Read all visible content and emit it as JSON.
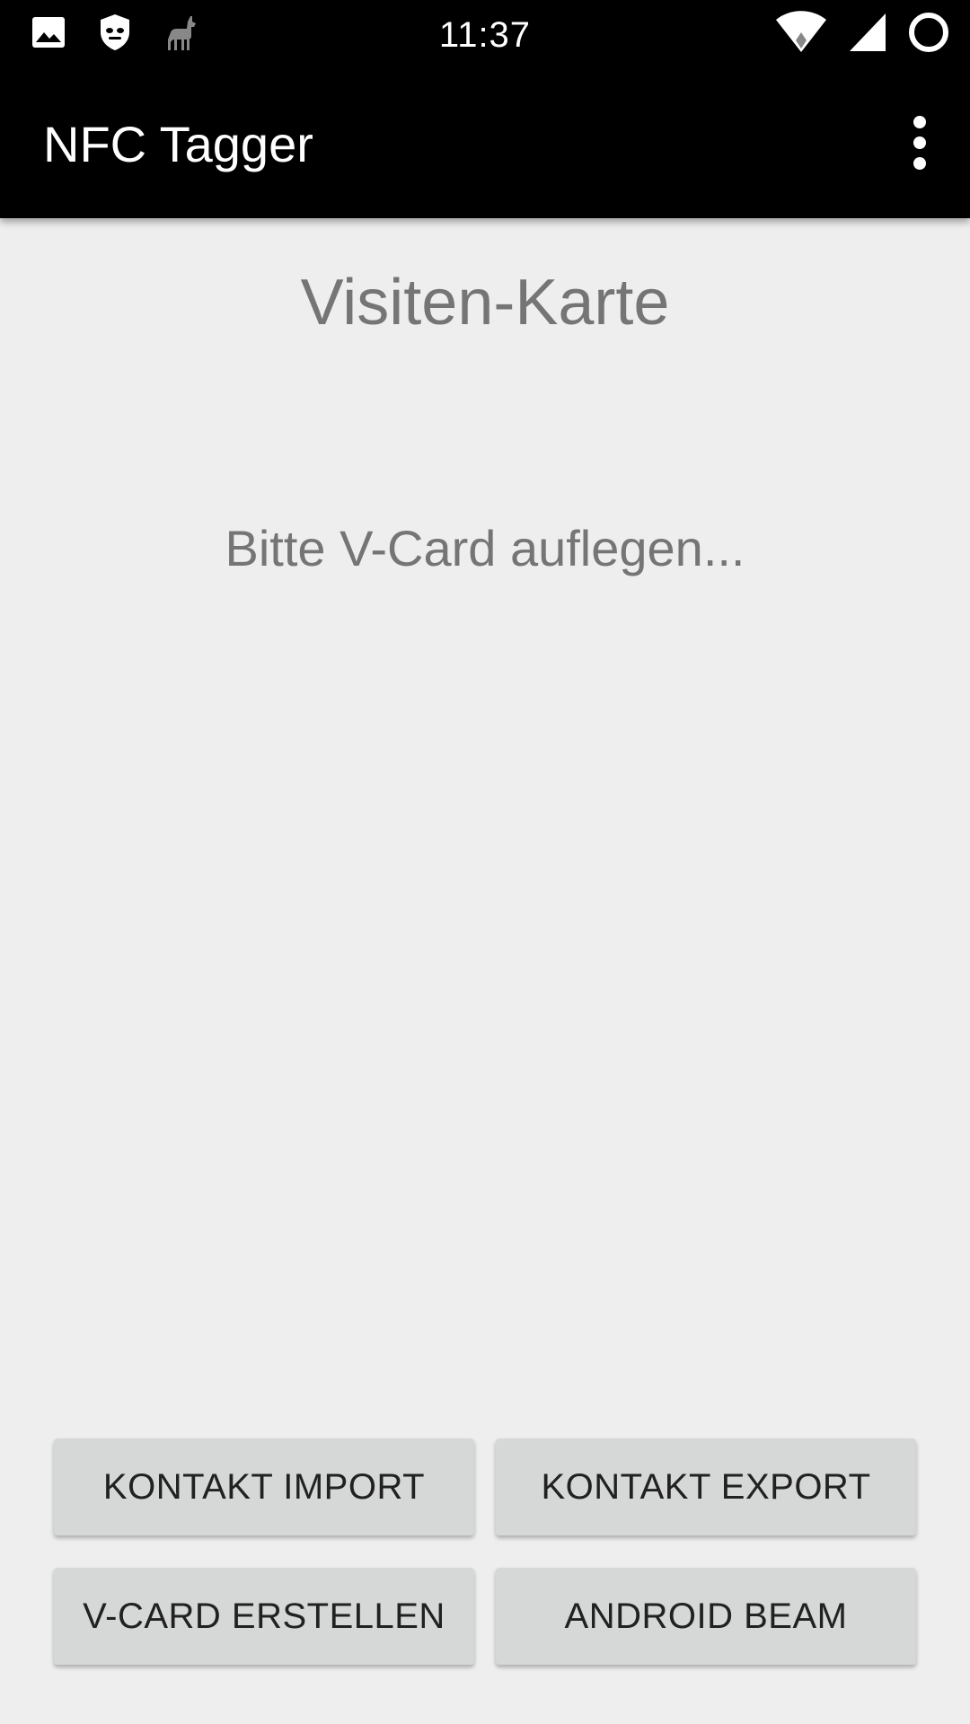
{
  "status_bar": {
    "time": "11:37",
    "left_icons": [
      "image-icon",
      "cyanogen-icon",
      "llama-icon"
    ],
    "right_icons": [
      "wifi-icon",
      "cell-signal-icon",
      "battery-ring-icon"
    ]
  },
  "app_bar": {
    "title": "NFC Tagger",
    "overflow_icon": "more-vert-icon"
  },
  "main": {
    "title": "Visiten-Karte",
    "prompt": "Bitte V-Card auflegen..."
  },
  "buttons": {
    "contact_import": "KONTAKT IMPORT",
    "contact_export": "KONTAKT EXPORT",
    "vcard_create": "V-CARD ERSTELLEN",
    "android_beam": "ANDROID BEAM"
  },
  "colors": {
    "bar_background": "#000000",
    "page_background": "#eeeeee",
    "button_background": "#d6d7d7",
    "secondary_text": "#757575"
  }
}
